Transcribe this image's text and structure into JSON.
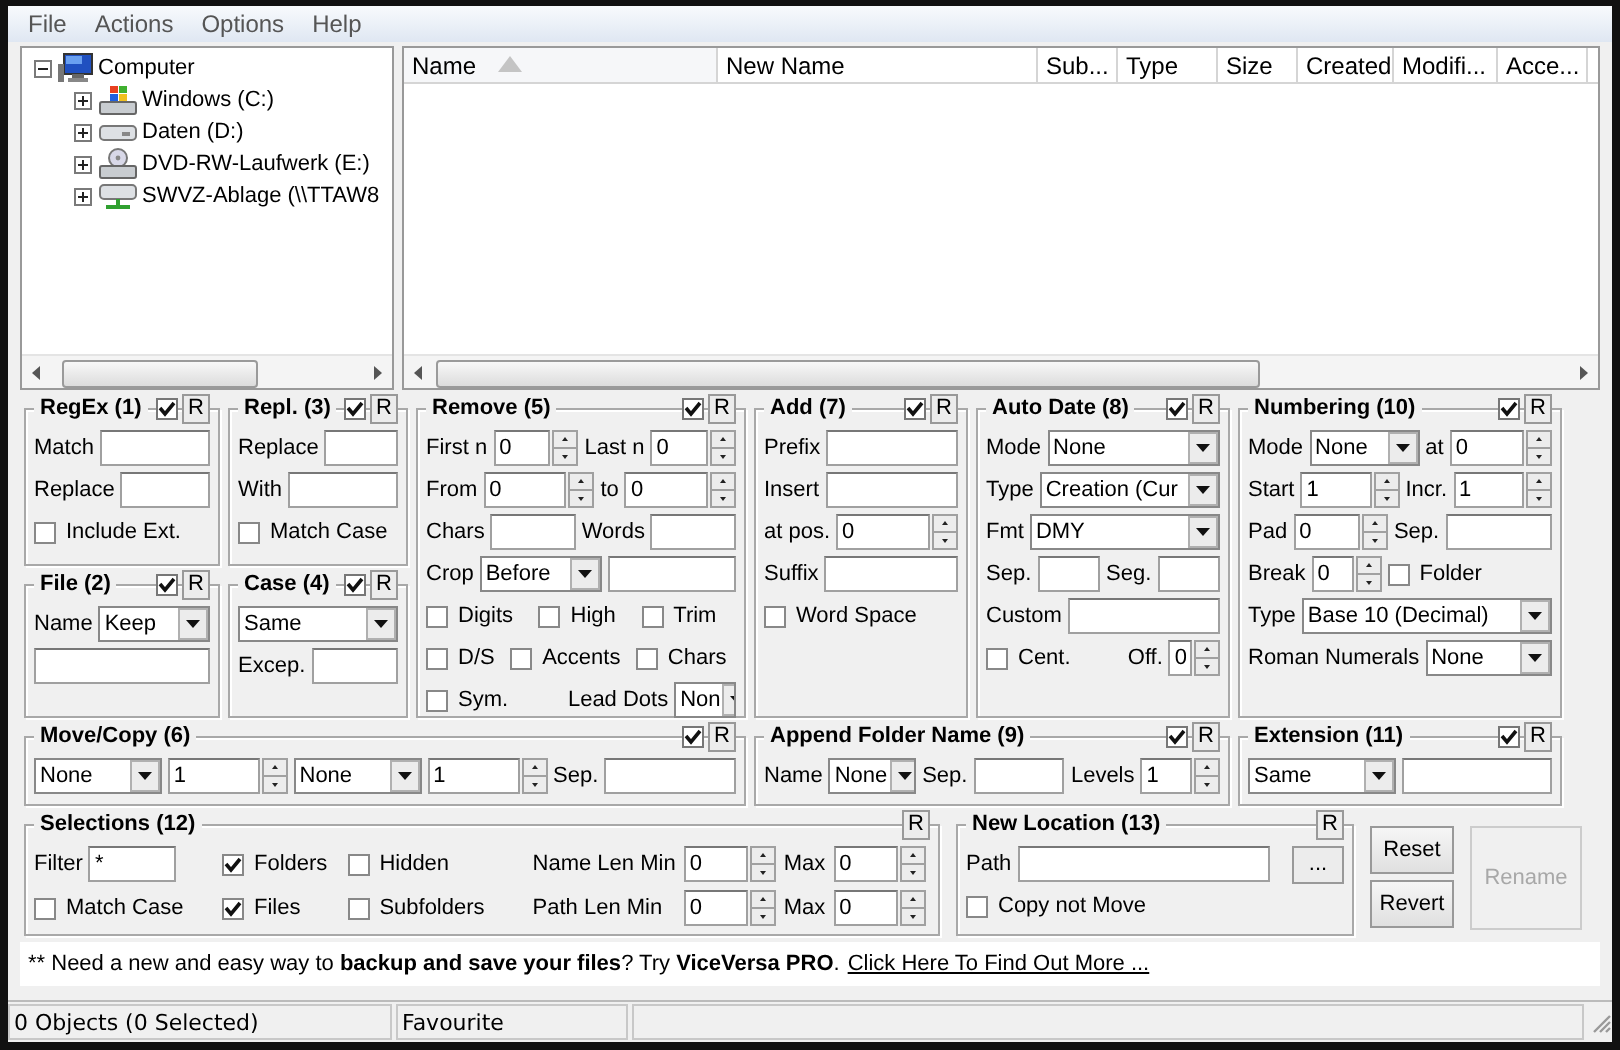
{
  "menu": [
    "File",
    "Actions",
    "Options",
    "Help"
  ],
  "tree": [
    {
      "label": "Computer",
      "kind": "computer",
      "expanded": true,
      "children": [
        {
          "label": "Windows (C:)",
          "kind": "system-drive",
          "expanded": false
        },
        {
          "label": "Daten (D:)",
          "kind": "drive",
          "expanded": false
        },
        {
          "label": "DVD-RW-Laufwerk (E:)",
          "kind": "optical-drive",
          "expanded": false
        },
        {
          "label": "SWVZ-Ablage (\\\\TTAW8",
          "kind": "network-drive",
          "expanded": false
        }
      ]
    }
  ],
  "columns": [
    {
      "label": "Name",
      "sorted": true
    },
    {
      "label": "New Name",
      "sorted": false
    },
    {
      "label": "Sub...",
      "sorted": false
    },
    {
      "label": "Type",
      "sorted": false
    },
    {
      "label": "Size",
      "sorted": false
    },
    {
      "label": "Created",
      "sorted": false
    },
    {
      "label": "Modifi...",
      "sorted": false
    },
    {
      "label": "Acce...",
      "sorted": false
    }
  ],
  "panels": [
    {
      "title": "RegEx (1)",
      "enabled": true,
      "r": "R",
      "rows": [
        [
          {
            "kind": "label",
            "text": "Match"
          },
          {
            "kind": "field"
          }
        ],
        [
          {
            "kind": "label",
            "text": "Replace"
          },
          {
            "kind": "field"
          }
        ],
        [
          {
            "kind": "check",
            "text": "Include Ext.",
            "checked": false
          }
        ]
      ]
    },
    {
      "title": "Repl. (3)",
      "enabled": true,
      "r": "R",
      "rows": [
        [
          {
            "kind": "label",
            "text": "Replace"
          },
          {
            "kind": "field"
          }
        ],
        [
          {
            "kind": "label",
            "text": "With"
          },
          {
            "kind": "field"
          }
        ],
        [
          {
            "kind": "check",
            "text": "Match Case",
            "checked": false
          }
        ]
      ]
    },
    {
      "title": "File (2)",
      "enabled": true,
      "r": "R",
      "rows": [
        [
          {
            "kind": "label",
            "text": "Name"
          },
          {
            "kind": "combo",
            "value": "Keep"
          }
        ],
        [
          {
            "kind": "field"
          }
        ]
      ]
    },
    {
      "title": "Case (4)",
      "enabled": true,
      "r": "R",
      "rows": [
        [
          {
            "kind": "combo",
            "value": "Same"
          }
        ],
        [
          {
            "kind": "label",
            "text": "Excep."
          },
          {
            "kind": "field"
          }
        ]
      ]
    },
    {
      "title": "Remove (5)",
      "enabled": true,
      "r": "R",
      "rows": [
        [
          {
            "kind": "label",
            "text": "First n"
          },
          {
            "kind": "spin",
            "value": "0"
          },
          {
            "kind": "label",
            "text": "Last n"
          },
          {
            "kind": "spin",
            "value": "0"
          }
        ],
        [
          {
            "kind": "label",
            "text": "From"
          },
          {
            "kind": "spin",
            "value": "0"
          },
          {
            "kind": "label",
            "text": "to"
          },
          {
            "kind": "spin",
            "value": "0"
          }
        ],
        [
          {
            "kind": "label",
            "text": "Chars"
          },
          {
            "kind": "field"
          },
          {
            "kind": "label",
            "text": "Words"
          },
          {
            "kind": "field"
          }
        ],
        [
          {
            "kind": "label",
            "text": "Crop"
          },
          {
            "kind": "combo",
            "value": "Before"
          },
          {
            "kind": "field"
          }
        ],
        [
          {
            "kind": "check",
            "text": "Digits",
            "checked": false
          },
          {
            "kind": "check",
            "text": "High",
            "checked": false
          },
          {
            "kind": "check",
            "text": "Trim",
            "checked": false
          }
        ],
        [
          {
            "kind": "check",
            "text": "D/S",
            "checked": false
          },
          {
            "kind": "check",
            "text": "Accents",
            "checked": false
          },
          {
            "kind": "check",
            "text": "Chars",
            "checked": false
          }
        ],
        [
          {
            "kind": "check",
            "text": "Sym.",
            "checked": false
          },
          {
            "kind": "label",
            "text": "Lead Dots"
          },
          {
            "kind": "combo",
            "value": "Non"
          }
        ]
      ]
    },
    {
      "title": "Add (7)",
      "enabled": true,
      "r": "R",
      "rows": [
        [
          {
            "kind": "label",
            "text": "Prefix"
          },
          {
            "kind": "field"
          }
        ],
        [
          {
            "kind": "label",
            "text": "Insert"
          },
          {
            "kind": "field"
          }
        ],
        [
          {
            "kind": "label",
            "text": "at pos."
          },
          {
            "kind": "spin",
            "value": "0"
          }
        ],
        [
          {
            "kind": "label",
            "text": "Suffix"
          },
          {
            "kind": "field"
          }
        ],
        [
          {
            "kind": "check",
            "text": "Word Space",
            "checked": false
          }
        ]
      ]
    },
    {
      "title": "Auto Date (8)",
      "enabled": true,
      "r": "R",
      "rows": [
        [
          {
            "kind": "label",
            "text": "Mode"
          },
          {
            "kind": "combo",
            "value": "None"
          }
        ],
        [
          {
            "kind": "label",
            "text": "Type"
          },
          {
            "kind": "combo",
            "value": "Creation (Cur"
          }
        ],
        [
          {
            "kind": "label",
            "text": "Fmt"
          },
          {
            "kind": "combo",
            "value": "DMY"
          }
        ],
        [
          {
            "kind": "label",
            "text": "Sep."
          },
          {
            "kind": "field"
          },
          {
            "kind": "label",
            "text": "Seg."
          },
          {
            "kind": "field"
          }
        ],
        [
          {
            "kind": "label",
            "text": "Custom"
          },
          {
            "kind": "field"
          }
        ],
        [
          {
            "kind": "check",
            "text": "Cent.",
            "checked": false
          },
          {
            "kind": "label",
            "text": "Off."
          },
          {
            "kind": "spin",
            "value": "0"
          }
        ]
      ]
    },
    {
      "title": "Numbering (10)",
      "enabled": true,
      "r": "R",
      "rows": [
        [
          {
            "kind": "label",
            "text": "Mode"
          },
          {
            "kind": "combo",
            "value": "None"
          },
          {
            "kind": "label",
            "text": "at"
          },
          {
            "kind": "spin",
            "value": "0"
          }
        ],
        [
          {
            "kind": "label",
            "text": "Start"
          },
          {
            "kind": "spin",
            "value": "1"
          },
          {
            "kind": "label",
            "text": "Incr."
          },
          {
            "kind": "spin",
            "value": "1"
          }
        ],
        [
          {
            "kind": "label",
            "text": "Pad"
          },
          {
            "kind": "spin",
            "value": "0"
          },
          {
            "kind": "label",
            "text": "Sep."
          },
          {
            "kind": "field"
          }
        ],
        [
          {
            "kind": "label",
            "text": "Break"
          },
          {
            "kind": "spin",
            "value": "0"
          },
          {
            "kind": "check",
            "text": "Folder",
            "checked": false
          }
        ],
        [
          {
            "kind": "label",
            "text": "Type"
          },
          {
            "kind": "combo",
            "value": "Base 10 (Decimal)"
          }
        ],
        [
          {
            "kind": "label",
            "text": "Roman Numerals"
          },
          {
            "kind": "combo",
            "value": "None"
          }
        ]
      ]
    },
    {
      "title": "Move/Copy (6)",
      "enabled": true,
      "r": "R",
      "rows": [
        [
          {
            "kind": "combo",
            "value": "None"
          },
          {
            "kind": "spin",
            "value": "1"
          },
          {
            "kind": "combo",
            "value": "None"
          },
          {
            "kind": "spin",
            "value": "1"
          },
          {
            "kind": "label",
            "text": "Sep."
          },
          {
            "kind": "field"
          }
        ]
      ]
    },
    {
      "title": "Append Folder Name (9)",
      "enabled": true,
      "r": "R",
      "rows": [
        [
          {
            "kind": "label",
            "text": "Name"
          },
          {
            "kind": "combo",
            "value": "None"
          },
          {
            "kind": "label",
            "text": "Sep."
          },
          {
            "kind": "field"
          },
          {
            "kind": "label",
            "text": "Levels"
          },
          {
            "kind": "spin",
            "value": "1"
          }
        ]
      ]
    },
    {
      "title": "Extension (11)",
      "enabled": true,
      "r": "R",
      "rows": [
        [
          {
            "kind": "combo",
            "value": "Same"
          },
          {
            "kind": "field"
          }
        ]
      ]
    }
  ],
  "bottom_panels": [
    {
      "title": "Selections (12)",
      "r": "R",
      "groups": [
        {
          "rows": [
            [
              {
                "kind": "label",
                "text": "Filter"
              },
              {
                "kind": "field",
                "value": "*"
              }
            ],
            [
              {
                "kind": "check",
                "text": "Match Case",
                "checked": false
              }
            ]
          ]
        },
        {
          "rows": [
            [
              {
                "kind": "check",
                "text": "Folders",
                "checked": true
              }
            ],
            [
              {
                "kind": "check",
                "text": "Files",
                "checked": true
              }
            ]
          ]
        },
        {
          "rows": [
            [
              {
                "kind": "check",
                "text": "Hidden",
                "checked": false
              }
            ],
            [
              {
                "kind": "check",
                "text": "Subfolders",
                "checked": false
              }
            ]
          ]
        },
        {
          "rows": [
            [
              {
                "kind": "label",
                "text": "Name Len Min"
              },
              {
                "kind": "spin",
                "value": "0"
              },
              {
                "kind": "label",
                "text": "Max"
              },
              {
                "kind": "spin",
                "value": "0"
              }
            ],
            [
              {
                "kind": "label",
                "text": "Path Len Min"
              },
              {
                "kind": "spin",
                "value": "0"
              },
              {
                "kind": "label",
                "text": "Max"
              },
              {
                "kind": "spin",
                "value": "0"
              }
            ]
          ]
        }
      ]
    },
    {
      "title": "New Location (13)",
      "r": "R",
      "rows": [
        [
          {
            "kind": "label",
            "text": "Path"
          },
          {
            "kind": "field"
          },
          {
            "kind": "button",
            "text": "..."
          }
        ],
        [
          {
            "kind": "check",
            "text": "Copy not Move",
            "checked": false
          }
        ]
      ]
    }
  ],
  "buttons": [
    {
      "label": "Reset",
      "disabled": false
    },
    {
      "label": "Revert",
      "disabled": false
    },
    {
      "label": "Rename",
      "disabled": true
    }
  ],
  "ad": {
    "lead": "**",
    "text": "Need a new and easy way to **backup and save your files**? Try **ViceVersa PRO**.",
    "link": "Click Here To Find Out More ..."
  },
  "status_bar": [
    "0 Objects (0 Selected)",
    "Favourite"
  ]
}
